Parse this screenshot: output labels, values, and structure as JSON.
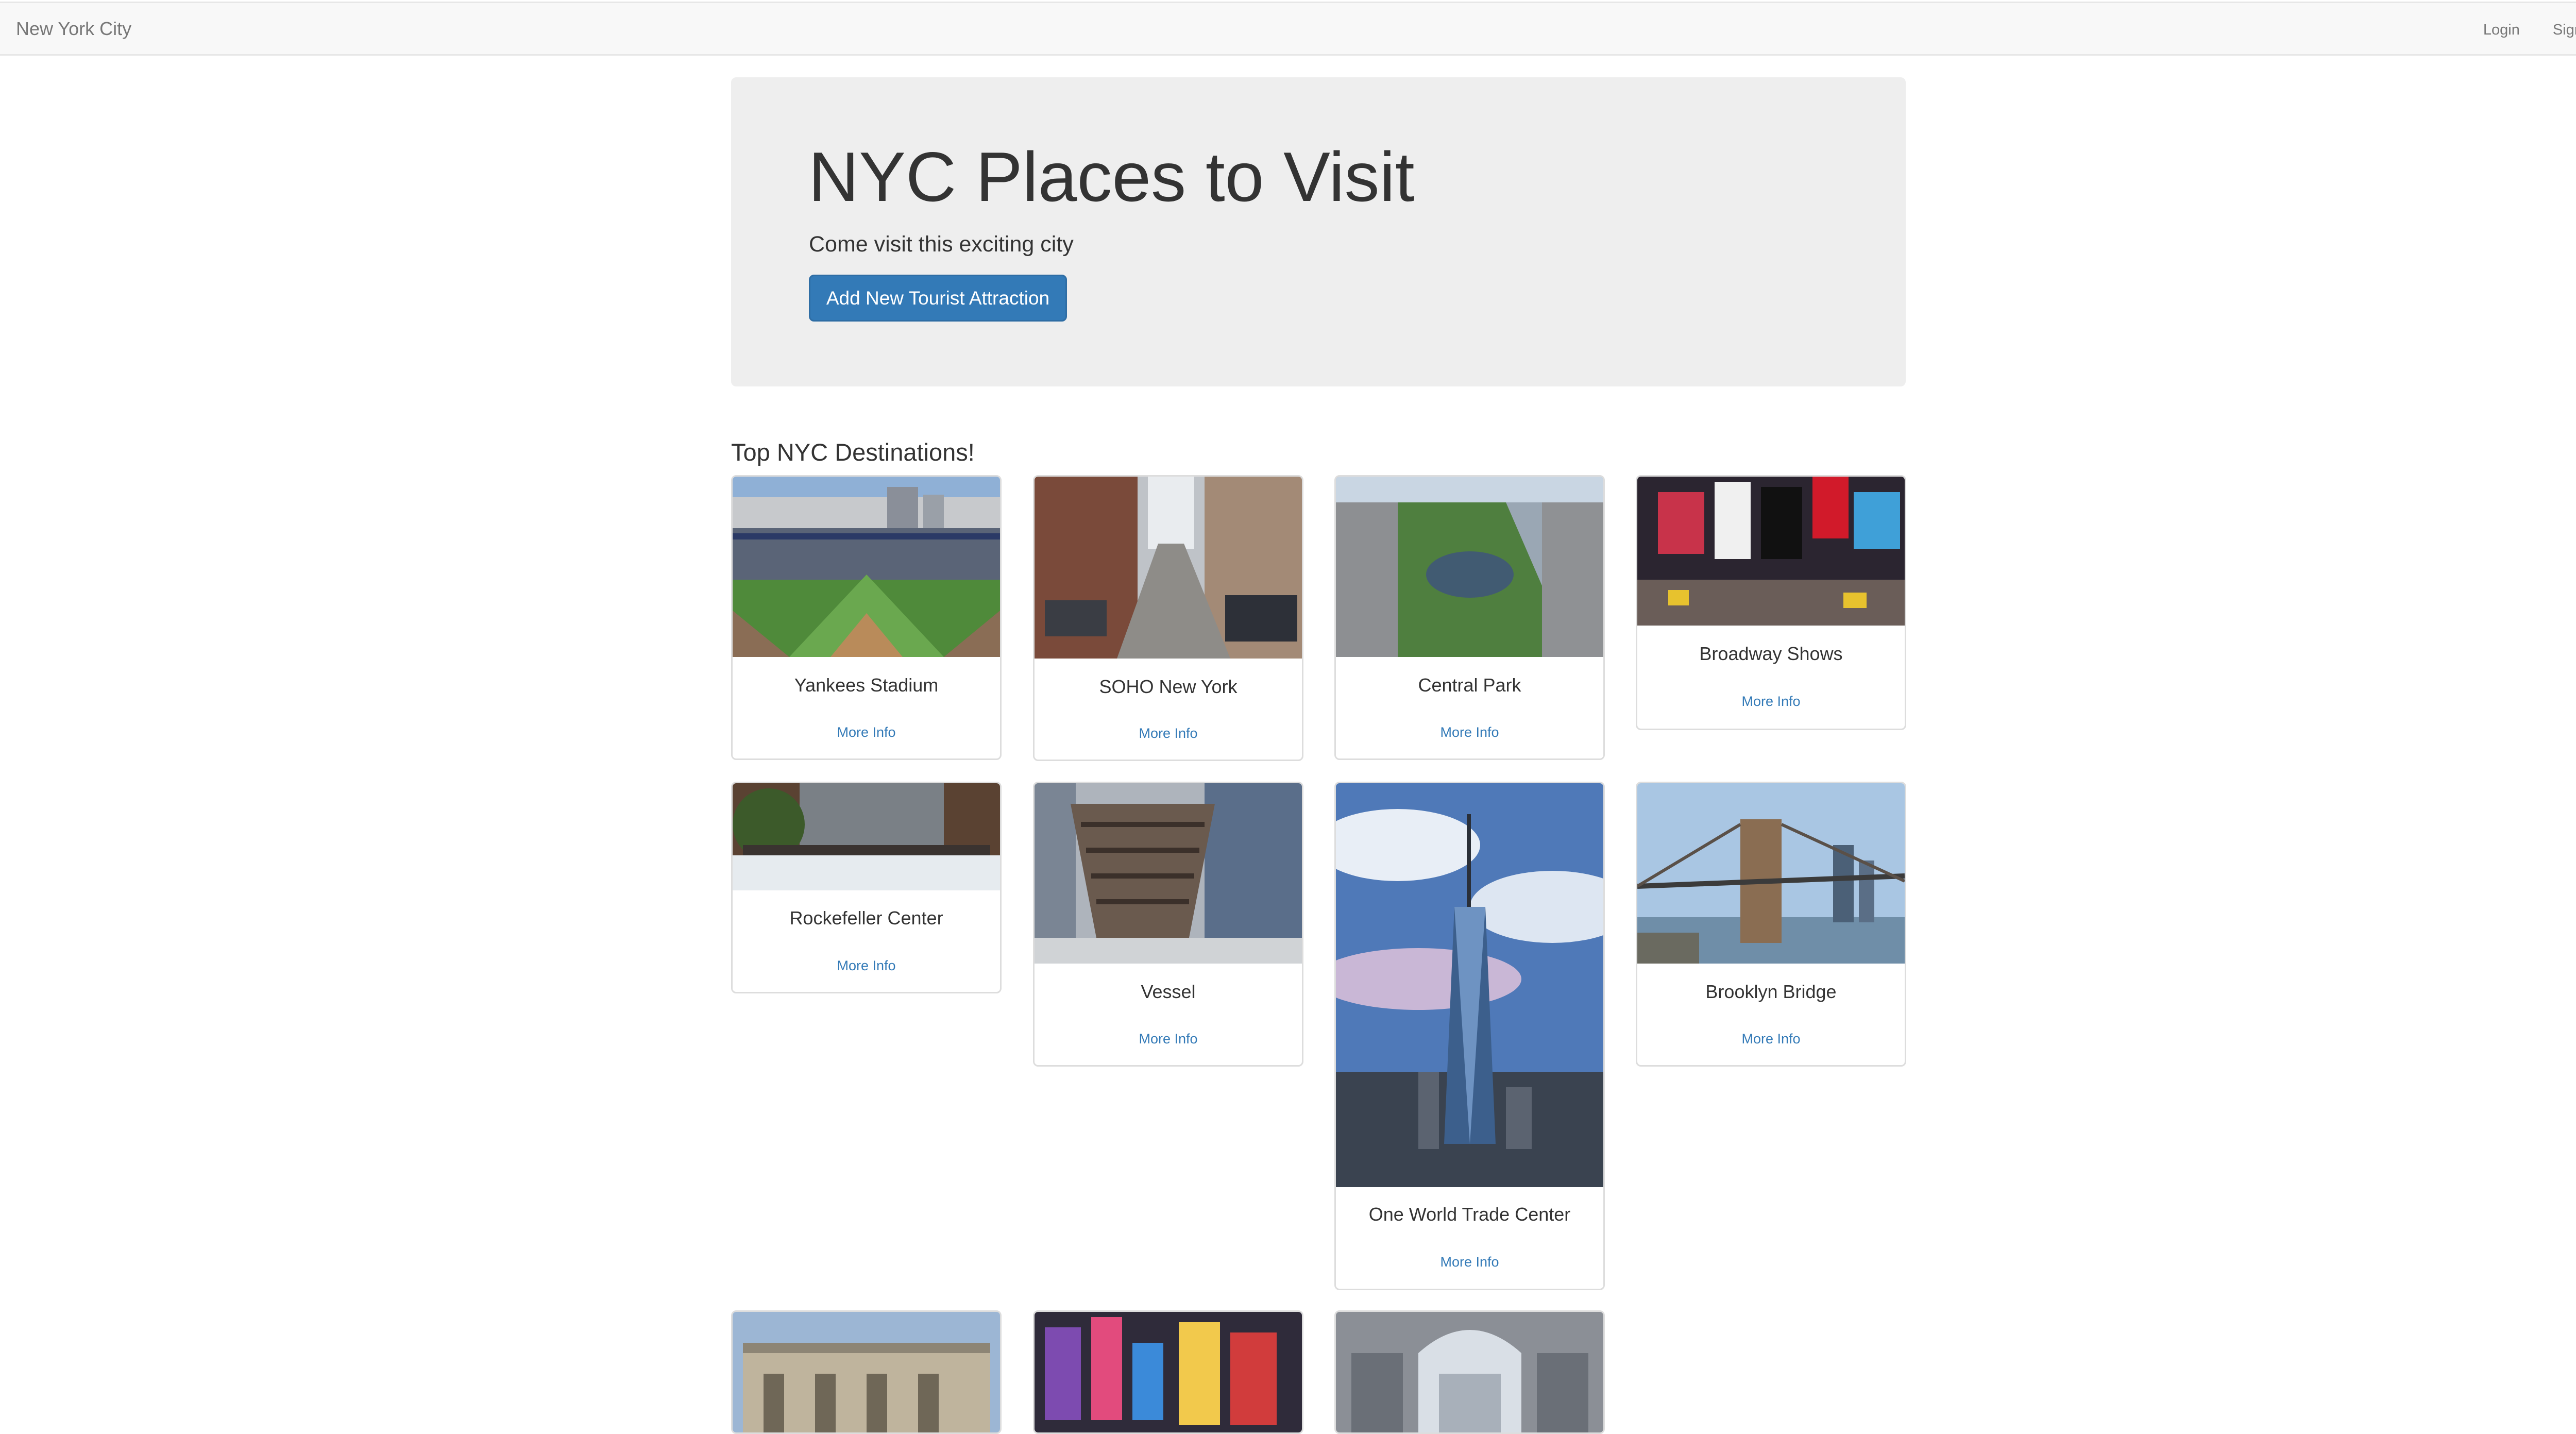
{
  "navbar": {
    "brand": "New York City",
    "links": [
      "Login",
      "Sign Up"
    ]
  },
  "jumbotron": {
    "title": "NYC Places to Visit",
    "subtitle": "Come visit this exciting city",
    "button_label": "Add New Tourist Attraction"
  },
  "section_title": "Top NYC Destinations!",
  "attractions": [
    {
      "name": "Yankees Stadium",
      "link": "More Info"
    },
    {
      "name": "SOHO New York",
      "link": "More Info"
    },
    {
      "name": "Central Park",
      "link": "More Info"
    },
    {
      "name": "Broadway Shows",
      "link": "More Info"
    },
    {
      "name": "Rockefeller Center",
      "link": "More Info"
    },
    {
      "name": "Vessel",
      "link": "More Info"
    },
    {
      "name": "One World Trade Center",
      "link": "More Info"
    },
    {
      "name": "Brooklyn Bridge",
      "link": "More Info"
    }
  ],
  "colors": {
    "primary": "#337ab7",
    "navbar_bg": "#f8f8f8",
    "jumbotron_bg": "#eeeeee"
  }
}
